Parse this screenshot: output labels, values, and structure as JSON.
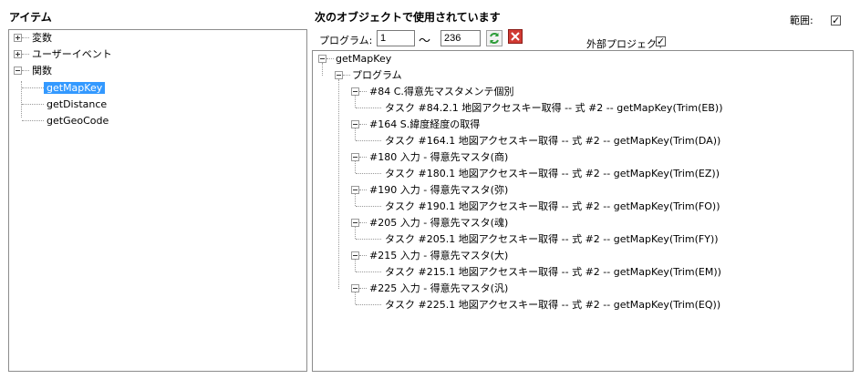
{
  "left": {
    "heading": "アイテム",
    "tree": {
      "variables": "変数",
      "user_events": "ユーザーイベント",
      "functions": "関数",
      "func_items": [
        "getMapKey",
        "getDistance",
        "getGeoCode"
      ]
    }
  },
  "right": {
    "heading": "次のオブジェクトで使用されています",
    "program_label": "プログラム:",
    "from_value": "1",
    "tilde": "～",
    "to_value": "236",
    "external_label": "外部プロジェクト",
    "scope_label": "範囲:",
    "external_checked": true,
    "scope_checked": true,
    "tree": {
      "root": "getMapKey",
      "group": "プログラム",
      "programs": [
        {
          "title": "#84 C.得意先マスタメンテ個別",
          "task": "タスク #84.2.1  地図アクセスキー取得  --  式 #2 -- getMapKey(Trim(EB))"
        },
        {
          "title": "#164 S.緯度経度の取得",
          "task": "タスク #164.1  地図アクセスキー取得  --  式 #2 -- getMapKey(Trim(DA))"
        },
        {
          "title": "#180 入力 - 得意先マスタ(商)",
          "task": "タスク #180.1  地図アクセスキー取得  --  式 #2 -- getMapKey(Trim(EZ))"
        },
        {
          "title": "#190 入力 - 得意先マスタ(弥)",
          "task": "タスク #190.1  地図アクセスキー取得  --  式 #2 -- getMapKey(Trim(FO))"
        },
        {
          "title": "#205 入力 - 得意先マスタ(魂)",
          "task": "タスク #205.1  地図アクセスキー取得  --  式 #2 -- getMapKey(Trim(FY))"
        },
        {
          "title": "#215 入力 - 得意先マスタ(大)",
          "task": "タスク #215.1  地図アクセスキー取得  --  式 #2 -- getMapKey(Trim(EM))"
        },
        {
          "title": "#225 入力 - 得意先マスタ(汎)",
          "task": "タスク #225.1  地図アクセスキー取得  --  式 #2 -- getMapKey(Trim(EQ))"
        }
      ]
    }
  },
  "icons": {
    "refresh": "refresh-icon",
    "clear": "clear-icon"
  },
  "colors": {
    "selection": "#3399ff",
    "refresh": "#2e9d3a",
    "clear": "#c8322d"
  }
}
